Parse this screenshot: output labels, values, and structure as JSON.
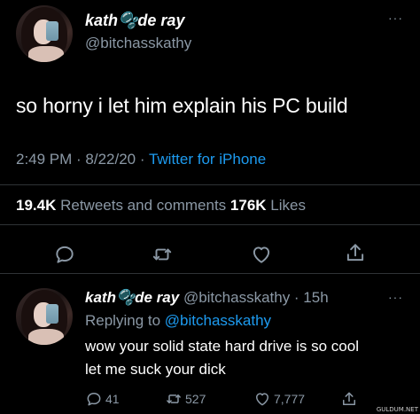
{
  "main_tweet": {
    "display_name": "kath🫧de ray",
    "handle": "@bitchasskathy",
    "text": "so horny i let him explain his PC build",
    "time": "2:49 PM · 8/22/20 · ",
    "source": "Twitter for iPhone",
    "retweets_count": "19.4K",
    "retweets_label": " Retweets and comments ",
    "likes_count": "176K",
    "likes_label": " Likes",
    "more_label": "···"
  },
  "reply_tweet": {
    "display_name": "kath🫧de ray",
    "handle_time": " @bitchasskathy · 15h",
    "replying_prefix": "Replying to ",
    "replying_mention": "@bitchasskathy",
    "text_line_1": "wow your solid state hard drive is so cool",
    "text_line_2": "let me suck your dick",
    "reply_count": "41",
    "retweet_count": "527",
    "like_count": "7,777",
    "more_label": "···"
  },
  "icons": {
    "reply": "reply-icon",
    "retweet": "retweet-icon",
    "like": "heart-icon",
    "share": "share-icon",
    "more": "more-icon"
  },
  "colors": {
    "background": "#000000",
    "text_primary": "#ffffff",
    "text_secondary": "#8b98a5",
    "accent": "#1d9bf0",
    "divider": "#2f3336"
  },
  "watermark": "GULDUM.NET"
}
